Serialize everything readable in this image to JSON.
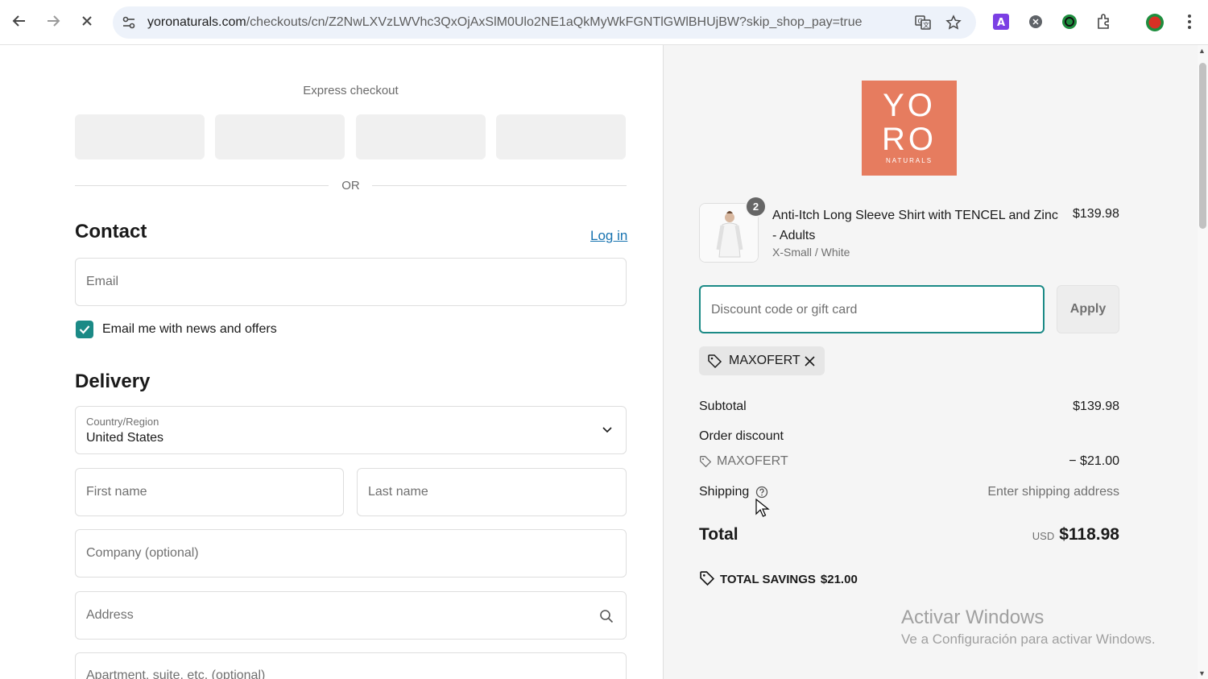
{
  "browser": {
    "url_host": "yoronaturals.com",
    "url_path": "/checkouts/cn/Z2NwLXVzLWVhc3QxOjAxSlM0Ulo2NE1aQkMyWkFGNTlGWlBHUjBW?skip_shop_pay=true",
    "icons": [
      "back-icon",
      "forward-icon",
      "stop-icon",
      "site-info-icon",
      "translate-icon",
      "star-icon",
      "extension-icons",
      "menu-icon"
    ]
  },
  "checkout": {
    "express_title": "Express checkout",
    "or_text": "OR",
    "contact_heading": "Contact",
    "login_link": "Log in",
    "email_placeholder": "Email",
    "newsletter_label": "Email me with news and offers",
    "delivery_heading": "Delivery",
    "country_label": "Country/Region",
    "country_value": "United States",
    "first_name_placeholder": "First name",
    "last_name_placeholder": "Last name",
    "company_placeholder": "Company (optional)",
    "address_placeholder": "Address",
    "apartment_placeholder": "Apartment, suite, etc. (optional)"
  },
  "summary": {
    "logo_line1": "YO",
    "logo_line2": "RO",
    "logo_line3": "NATURALS",
    "product": {
      "quantity": "2",
      "name": "Anti-Itch Long Sleeve Shirt with TENCEL and Zinc - Adults",
      "variant": "X-Small / White",
      "price": "$139.98"
    },
    "discount_placeholder": "Discount code or gift card",
    "apply_label": "Apply",
    "applied_code": "MAXOFERT",
    "subtotal_label": "Subtotal",
    "subtotal_value": "$139.98",
    "order_discount_label": "Order discount",
    "discount_code": "MAXOFERT",
    "discount_value": "− $21.00",
    "shipping_label": "Shipping",
    "shipping_value": "Enter shipping address",
    "total_label": "Total",
    "total_currency": "USD",
    "total_value": "$118.98",
    "savings_label": "TOTAL SAVINGS",
    "savings_value": "$21.00",
    "watermark_title": "Activar Windows",
    "watermark_sub": "Ve a Configuración para activar Windows."
  },
  "colors": {
    "accent": "#1b8a86",
    "link": "#1773b0",
    "logo_bg": "#e67c5f"
  }
}
